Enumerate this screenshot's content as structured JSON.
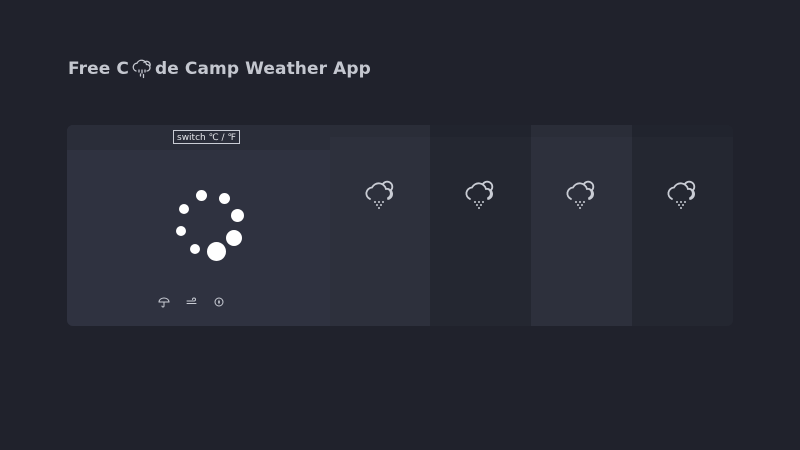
{
  "header": {
    "title_prefix": "Free C",
    "title_suffix": "de Camp Weather App",
    "logo_icon": "rain-cloud-icon"
  },
  "today": {
    "switch_label": "switch ℃ / ℉",
    "loading_icon": "loading-spinner-icon",
    "details": [
      {
        "icon": "umbrella-icon"
      },
      {
        "icon": "wind-icon"
      },
      {
        "icon": "compass-icon"
      }
    ]
  },
  "forecast": [
    {
      "icon": "rain-cloud-icon"
    },
    {
      "icon": "rain-cloud-icon"
    },
    {
      "icon": "rain-cloud-icon"
    },
    {
      "icon": "rain-cloud-icon"
    }
  ],
  "colors": {
    "background": "#20222c",
    "panel_today": "#2f3240",
    "panel_day_odd": "#242731",
    "panel_day_even": "#2d303c",
    "title": "#c4c7cf",
    "icon": "#c9ccd4"
  }
}
